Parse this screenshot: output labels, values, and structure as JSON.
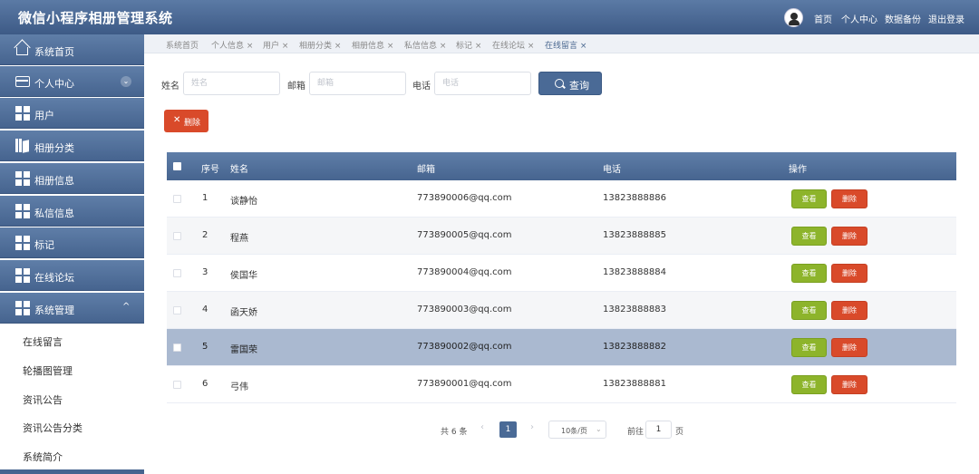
{
  "header": {
    "title": "微信小程序相册管理系统",
    "nav": [
      "首页",
      "个人中心",
      "数据备份",
      "退出登录"
    ]
  },
  "sidebar": {
    "items": [
      {
        "label": "系统首页",
        "icon": "home-icon"
      },
      {
        "label": "个人中心",
        "icon": "card-icon",
        "chevron": "⌄"
      },
      {
        "label": "用户",
        "icon": "grid-icon"
      },
      {
        "label": "相册分类",
        "icon": "book-icon"
      },
      {
        "label": "相册信息",
        "icon": "grid-icon"
      },
      {
        "label": "私信信息",
        "icon": "grid-icon"
      },
      {
        "label": "标记",
        "icon": "grid-icon"
      },
      {
        "label": "在线论坛",
        "icon": "grid-icon"
      },
      {
        "label": "系统管理",
        "icon": "grid-icon",
        "chevron": "^"
      }
    ],
    "submenu": [
      "在线留言",
      "轮播图管理",
      "资讯公告",
      "资讯公告分类",
      "系统简介"
    ]
  },
  "tabs": [
    "系统首页",
    "个人信息 ×",
    "用户 ×",
    "相册分类 ×",
    "相册信息 ×",
    "私信信息 ×",
    "标记 ×",
    "在线论坛 ×",
    "在线留言 ×"
  ],
  "search": {
    "name_label": "姓名",
    "name_placeholder": "姓名",
    "email_label": "邮箱",
    "email_placeholder": "邮箱",
    "phone_label": "电话",
    "phone_placeholder": "电话",
    "query_label": "查询"
  },
  "toolbar": {
    "delete_label": "删除",
    "delete_x": "✕"
  },
  "table": {
    "headers": {
      "index": "序号",
      "name": "姓名",
      "email": "邮箱",
      "phone": "电话",
      "action": "操作"
    },
    "rows": [
      {
        "index": "1",
        "name": "谈静怡",
        "email": "773890006@qq.com",
        "phone": "13823888886"
      },
      {
        "index": "2",
        "name": "程燕",
        "email": "773890005@qq.com",
        "phone": "13823888885"
      },
      {
        "index": "3",
        "name": "侯国华",
        "email": "773890004@qq.com",
        "phone": "13823888884"
      },
      {
        "index": "4",
        "name": "函天娇",
        "email": "773890003@qq.com",
        "phone": "13823888883"
      },
      {
        "index": "5",
        "name": "雷国荣",
        "email": "773890002@qq.com",
        "phone": "13823888882"
      },
      {
        "index": "6",
        "name": "弓伟",
        "email": "773890001@qq.com",
        "phone": "13823888881"
      }
    ],
    "view_label": "查看",
    "delete_label": "删除"
  },
  "pagination": {
    "total": "共 6 条",
    "prev": "‹",
    "current": "1",
    "next": "›",
    "page_size": "10条/页",
    "goto_label": "前往",
    "goto_value": "1",
    "page_unit": "页"
  },
  "colors": {
    "primary": "#4a6a96",
    "view": "#8db42b",
    "danger": "#d94a2a",
    "highlight_row": "#aab9d0"
  }
}
